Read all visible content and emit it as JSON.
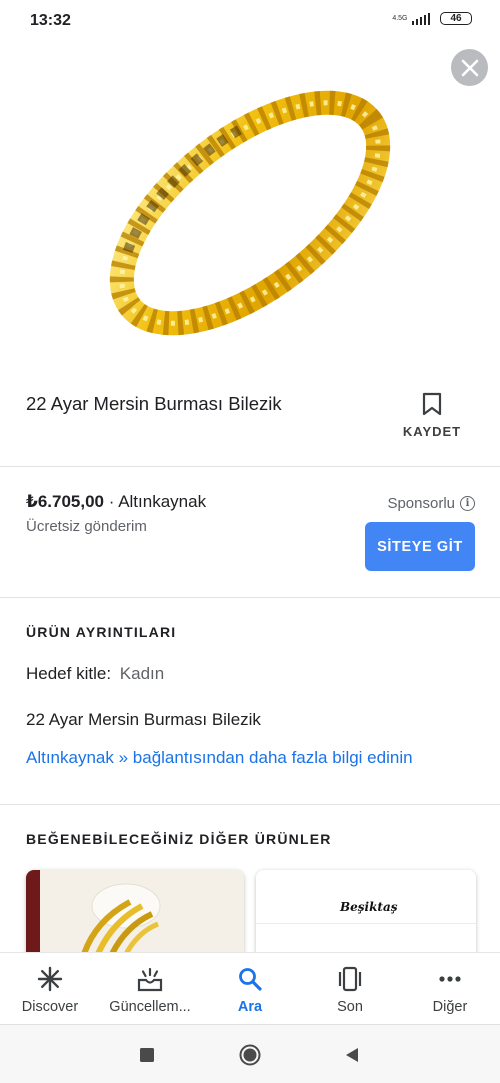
{
  "status_bar": {
    "time": "13:32",
    "network": "4.5G",
    "battery": "46"
  },
  "product": {
    "title": "22 Ayar Mersin Burması Bilezik",
    "save_label": "KAYDET",
    "price": "₺6.705,00",
    "separator": " · ",
    "seller": "Altınkaynak",
    "shipping": "Ücretsiz gönderim",
    "sponsored": "Sponsorlu",
    "visit_site_button": "SİTEYE GİT"
  },
  "details": {
    "heading": "ÜRÜN AYRINTILARI",
    "audience_label": "Hedef kitle:",
    "audience_value": "Kadın",
    "product_name": "22 Ayar Mersin Burması Bilezik",
    "more_link": "Altınkaynak » bağlantısından daha fazla bilgi edinin"
  },
  "similar": {
    "heading": "BEĞENEBİLECEĞİNİZ DİĞER ÜRÜNLER",
    "card_2_brand": "Beşiktaş"
  },
  "bottom_nav": {
    "items": [
      {
        "label": "Discover",
        "icon": "asterisk-icon",
        "active": false
      },
      {
        "label": "Güncellem...",
        "icon": "updates-icon",
        "active": false
      },
      {
        "label": "Ara",
        "icon": "search-icon",
        "active": true
      },
      {
        "label": "Son",
        "icon": "recent-tabs-icon",
        "active": false
      },
      {
        "label": "Diğer",
        "icon": "more-dots-icon",
        "active": false
      }
    ]
  },
  "colors": {
    "accent": "#4285f4",
    "link": "#1a73e8",
    "gold": "#f2c010",
    "text_primary": "#202124",
    "text_secondary": "#5f6368"
  }
}
